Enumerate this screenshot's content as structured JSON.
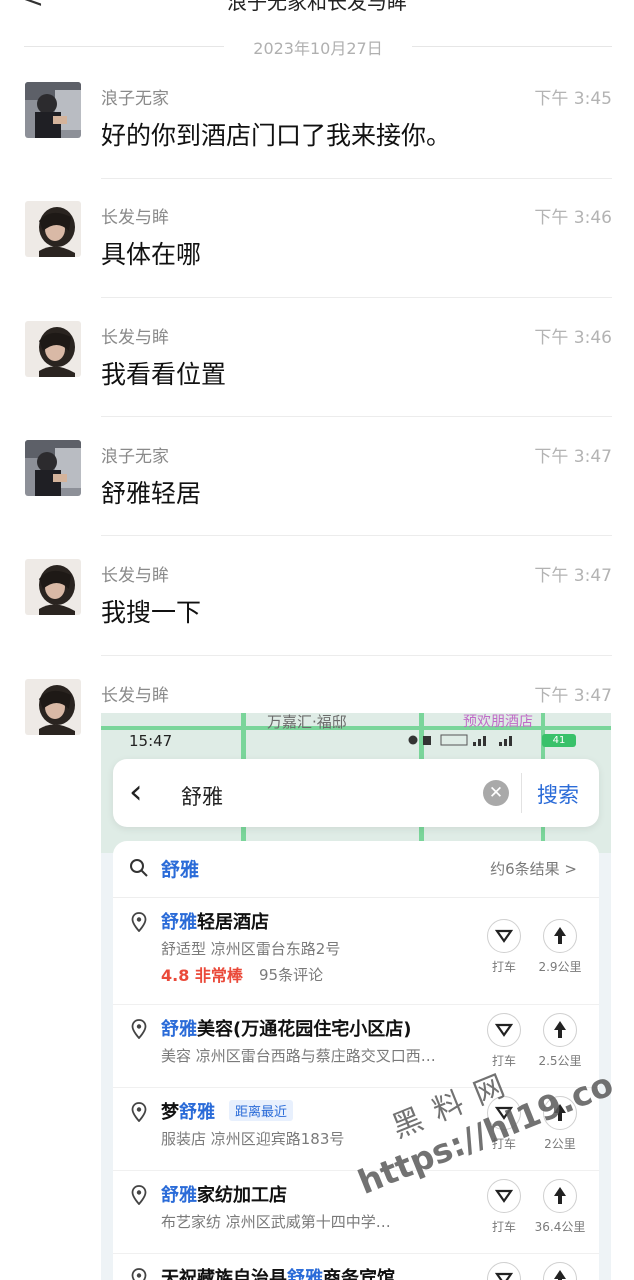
{
  "header": {
    "title": "浪子无家和长发与眸"
  },
  "date_divider": "2023年10月27日",
  "messages": [
    {
      "sender": "浪子无家",
      "time": "下午 3:45",
      "text": "好的你到酒店门口了我来接你。"
    },
    {
      "sender": "长发与眸",
      "time": "下午 3:46",
      "text": "具体在哪"
    },
    {
      "sender": "长发与眸",
      "time": "下午 3:46",
      "text": "我看看位置"
    },
    {
      "sender": "浪子无家",
      "time": "下午 3:47",
      "text": "舒雅轻居"
    },
    {
      "sender": "长发与眸",
      "time": "下午 3:47",
      "text": "我搜一下"
    },
    {
      "sender": "长发与眸",
      "time": "下午 3:47"
    }
  ],
  "screenshot": {
    "status_time": "15:47",
    "map_labels": [
      "万嘉汇·福邸",
      "预欢朋酒店"
    ],
    "battery": "41",
    "search": {
      "query": "舒雅",
      "search_button": "搜索"
    },
    "suggestion": {
      "keyword": "舒雅",
      "count": "约6条结果 >"
    },
    "results": [
      {
        "highlight": "舒雅",
        "rest": "轻居酒店",
        "sub": "舒适型  凉州区雷台东路2号",
        "rating": "4.8 非常棒",
        "reviews": "95条评论",
        "action1": "打车",
        "action2": "2.9公里"
      },
      {
        "highlight": "舒雅",
        "rest": "美容(万通花园住宅小区店)",
        "sub": "美容  凉州区雷台西路与蔡庄路交叉口西…",
        "action1": "打车",
        "action2": "2.5公里"
      },
      {
        "prefix": "梦",
        "highlight": "舒雅",
        "rest": "",
        "tag": "距离最近",
        "sub": "服装店  凉州区迎宾路183号",
        "action1": "打车",
        "action2": "2公里"
      },
      {
        "highlight": "舒雅",
        "rest": "家纺加工店",
        "sub": "布艺家纺  凉州区武威第十四中学…",
        "action1": "打车",
        "action2": "36.4公里"
      },
      {
        "prefix": "天祝藏族自治县",
        "highlight": "舒雅",
        "rest": "商务宾馆"
      }
    ]
  },
  "watermark": {
    "line1": "黑料网",
    "line2": "https://hl19.co"
  },
  "colors": {
    "link_blue": "#2a6bd8",
    "rating_red": "#ea4a3a",
    "road_green": "#7ad59a"
  }
}
